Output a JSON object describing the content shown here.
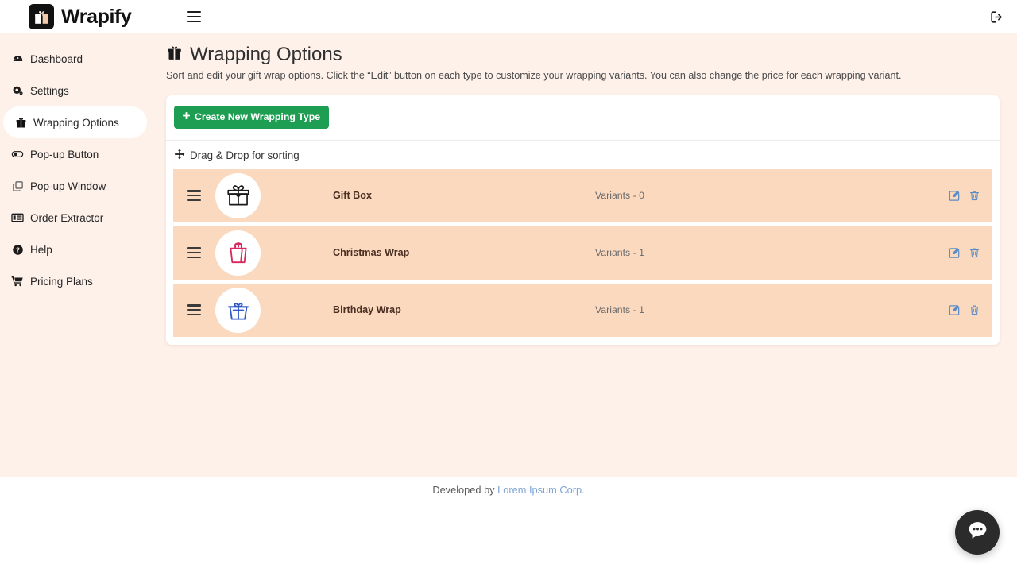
{
  "brand": {
    "name": "Wrapify",
    "logo_icon": "gift-logo-icon"
  },
  "topbar": {
    "menu_icon": "hamburger-menu-icon",
    "logout_icon": "logout-icon"
  },
  "sidebar": {
    "items": [
      {
        "label": "Dashboard",
        "icon": "dashboard-icon",
        "active": false
      },
      {
        "label": "Settings",
        "icon": "gear-icon",
        "active": false
      },
      {
        "label": "Wrapping Options",
        "icon": "gift-icon",
        "active": true
      },
      {
        "label": "Pop-up Button",
        "icon": "toggle-icon",
        "active": false
      },
      {
        "label": "Pop-up Window",
        "icon": "window-copy-icon",
        "active": false
      },
      {
        "label": "Order Extractor",
        "icon": "list-icon",
        "active": false
      },
      {
        "label": "Help",
        "icon": "question-circle-icon",
        "active": false
      },
      {
        "label": "Pricing Plans",
        "icon": "shopping-cart-icon",
        "active": false
      }
    ]
  },
  "page": {
    "title": "Wrapping Options",
    "title_icon": "gift-icon",
    "subtitle": "Sort and edit your gift wrap options. Click the “Edit” button on each type to customize your wrapping variants. You can also change the price for each wrapping variant."
  },
  "card": {
    "create_button": {
      "label": "Create New Wrapping Type",
      "icon": "plus-icon",
      "color": "#1e9e52"
    },
    "drag_hint": {
      "label": "Drag & Drop for sorting",
      "icon": "move-arrows-icon"
    },
    "row_background": "#FBD9BF",
    "rows": [
      {
        "name": "Gift Box",
        "variants": "Variants - 0",
        "icon": "gift-box-icon",
        "icon_color": "#1a1a1a",
        "handle_icon": "drag-handle-icon",
        "edit_icon": "edit-pencil-icon",
        "delete_icon": "trash-icon"
      },
      {
        "name": "Christmas Wrap",
        "variants": "Variants - 1",
        "icon": "shopping-bag-icon",
        "icon_color": "#d62a5e",
        "handle_icon": "drag-handle-icon",
        "edit_icon": "edit-pencil-icon",
        "delete_icon": "trash-icon"
      },
      {
        "name": "Birthday Wrap",
        "variants": "Variants - 1",
        "icon": "gift-bag-icon",
        "icon_color": "#2f58c4",
        "handle_icon": "drag-handle-icon",
        "edit_icon": "edit-pencil-icon",
        "delete_icon": "trash-icon"
      }
    ]
  },
  "footer": {
    "prefix": "Developed by ",
    "link": "Lorem Ipsum Corp.",
    "suffix": ""
  },
  "chat": {
    "icon": "chat-bubble-icon"
  },
  "colors": {
    "page_bg": "#FEF1EA",
    "row_bg": "#FBD9BF",
    "accent_green": "#1e9e52",
    "action_blue": "#5b8cc4",
    "link_blue": "#7fa4d4"
  }
}
